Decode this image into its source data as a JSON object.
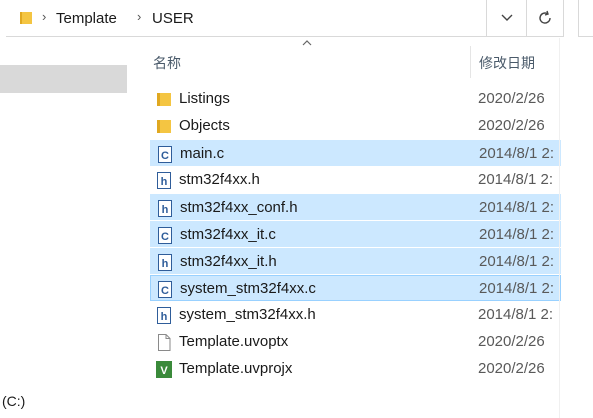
{
  "address_bar": {
    "crumbs": [
      "Template",
      "USER"
    ],
    "dropdown_icon": "chevron-down-icon",
    "refresh_icon": "refresh-icon"
  },
  "nav": {
    "drive_label": "(C:)"
  },
  "columns": {
    "name": "名称",
    "modified": "修改日期"
  },
  "files": [
    {
      "name": "Listings",
      "date": "2020/2/26",
      "icon": "folder-icon",
      "selected": false
    },
    {
      "name": "Objects",
      "date": "2020/2/26",
      "icon": "folder-icon",
      "selected": false
    },
    {
      "name": "main.c",
      "date": "2014/8/1 2:",
      "icon": "c-file-icon",
      "selected": true
    },
    {
      "name": "stm32f4xx.h",
      "date": "2014/8/1 2:",
      "icon": "h-file-icon",
      "selected": false
    },
    {
      "name": "stm32f4xx_conf.h",
      "date": "2014/8/1 2:",
      "icon": "h-file-icon",
      "selected": true
    },
    {
      "name": "stm32f4xx_it.c",
      "date": "2014/8/1 2:",
      "icon": "c-file-icon",
      "selected": true
    },
    {
      "name": "stm32f4xx_it.h",
      "date": "2014/8/1 2:",
      "icon": "h-file-icon",
      "selected": true
    },
    {
      "name": "system_stm32f4xx.c",
      "date": "2014/8/1 2:",
      "icon": "c-file-icon",
      "selected": true
    },
    {
      "name": "system_stm32f4xx.h",
      "date": "2014/8/1 2:",
      "icon": "h-file-icon",
      "selected": false
    },
    {
      "name": "Template.uvoptx",
      "date": "2020/2/26",
      "icon": "file-icon",
      "selected": false
    },
    {
      "name": "Template.uvprojx",
      "date": "2020/2/26",
      "icon": "uvision-project-icon",
      "selected": false
    }
  ],
  "colors": {
    "selection": "#cce8ff",
    "selection_focus_border": "#99d1ff",
    "folder": "#f4c542",
    "icon_blue": "#2f5d9a",
    "uvision_green": "#3a8a3a"
  }
}
